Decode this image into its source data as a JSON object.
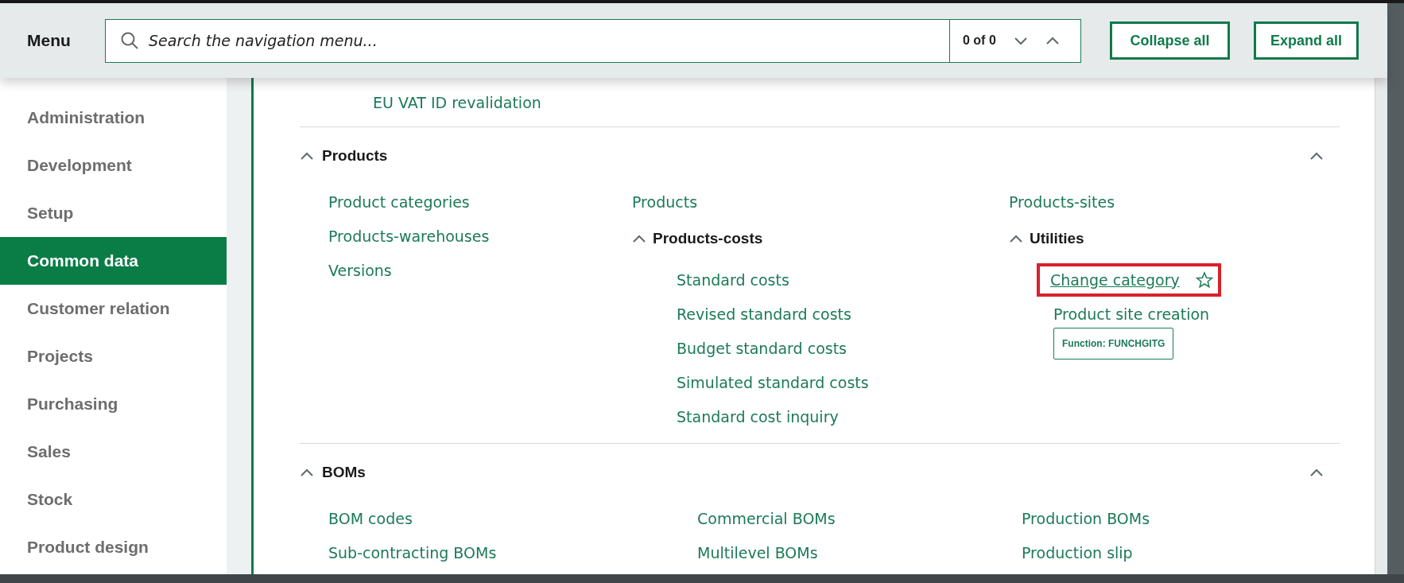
{
  "header": {
    "title": "Menu",
    "search": {
      "placeholder": "Search the navigation menu..."
    },
    "counter": "0 of 0",
    "buttons": [
      "Collapse all",
      "Expand all"
    ]
  },
  "sidebar": {
    "items": [
      {
        "label": "Administration",
        "selected": false
      },
      {
        "label": "Development",
        "selected": false
      },
      {
        "label": "Setup",
        "selected": false
      },
      {
        "label": "Common data",
        "selected": true
      },
      {
        "label": "Customer relation",
        "selected": false
      },
      {
        "label": "Projects",
        "selected": false
      },
      {
        "label": "Purchasing",
        "selected": false
      },
      {
        "label": "Sales",
        "selected": false
      },
      {
        "label": "Stock",
        "selected": false
      },
      {
        "label": "Product design",
        "selected": false
      }
    ]
  },
  "content": {
    "leading_link": "EU VAT ID revalidation",
    "sections": [
      {
        "title": "Products",
        "expanded": true,
        "columns": [
          [
            {
              "kind": "link",
              "label": "Product categories"
            },
            {
              "kind": "link",
              "label": "Products-warehouses"
            },
            {
              "kind": "link",
              "label": "Versions"
            }
          ],
          [
            {
              "kind": "link",
              "label": "Products"
            },
            {
              "kind": "group",
              "label": "Products-costs",
              "expanded": true,
              "children": [
                {
                  "kind": "link",
                  "label": "Standard costs"
                },
                {
                  "kind": "link",
                  "label": "Revised standard costs"
                },
                {
                  "kind": "link",
                  "label": "Budget standard costs"
                },
                {
                  "kind": "link",
                  "label": "Simulated standard costs"
                },
                {
                  "kind": "link",
                  "label": "Standard cost inquiry"
                }
              ]
            }
          ],
          [
            {
              "kind": "link",
              "label": "Products-sites"
            },
            {
              "kind": "group",
              "label": "Utilities",
              "expanded": true,
              "children": [
                {
                  "kind": "link",
                  "label": "Change category",
                  "hovered": true,
                  "highlighted": true,
                  "favorite": false,
                  "tooltip": "Function: FUNCHGITG"
                },
                {
                  "kind": "link",
                  "label": "Product site creation"
                }
              ]
            }
          ]
        ]
      },
      {
        "title": "BOMs",
        "expanded": true,
        "columns": [
          [
            {
              "kind": "link",
              "label": "BOM codes"
            },
            {
              "kind": "link",
              "label": "Sub-contracting BOMs"
            }
          ],
          [
            {
              "kind": "link",
              "label": "Commercial BOMs"
            },
            {
              "kind": "link",
              "label": "Multilevel BOMs"
            }
          ],
          [
            {
              "kind": "link",
              "label": "Production BOMs"
            },
            {
              "kind": "link",
              "label": "Production slip"
            }
          ]
        ]
      }
    ]
  }
}
